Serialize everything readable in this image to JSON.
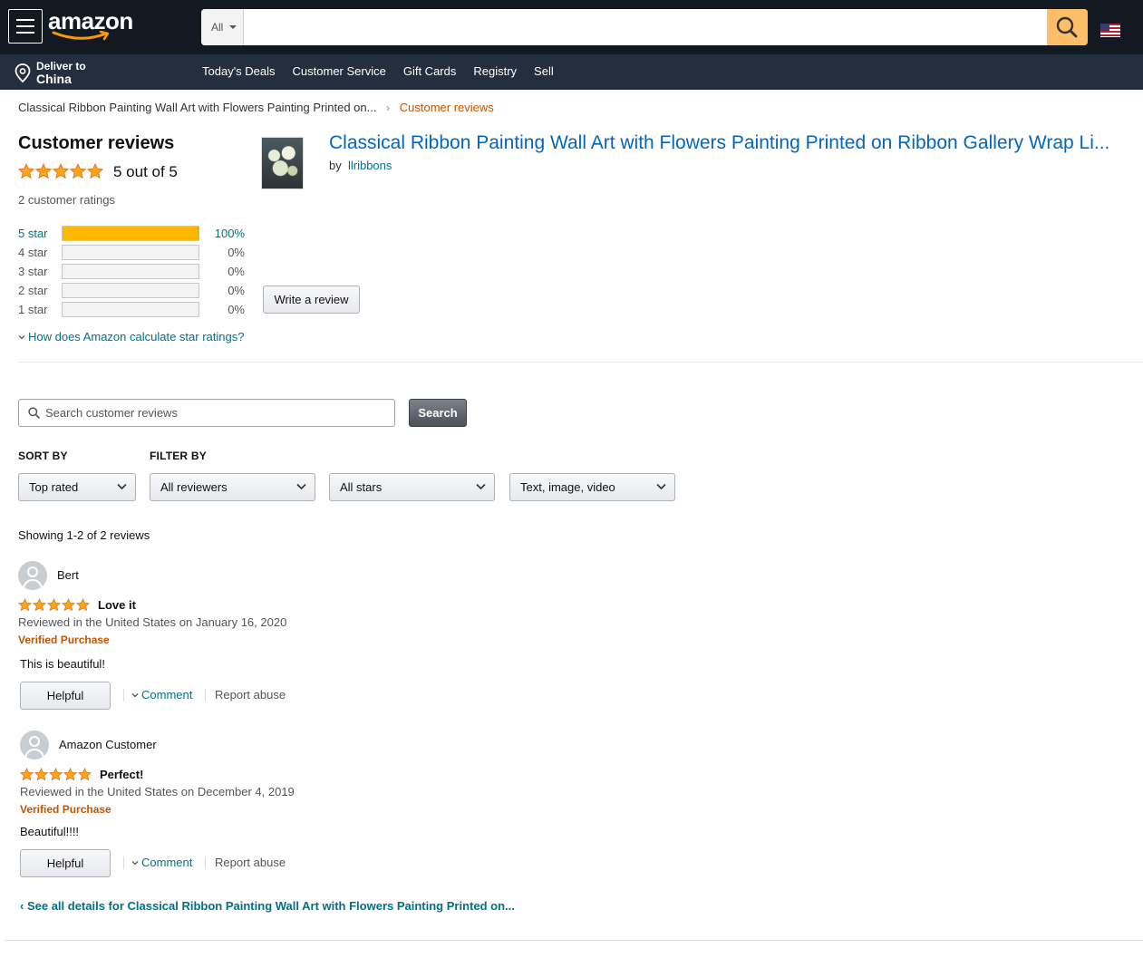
{
  "nav": {
    "logo": "amazon",
    "search_category": "All",
    "search_placeholder": "",
    "deliver_line1": "Deliver to",
    "deliver_line2": "China",
    "links": [
      "Today's Deals",
      "Customer Service",
      "Gift Cards",
      "Registry",
      "Sell"
    ]
  },
  "breadcrumb": {
    "product": "Classical Ribbon Painting Wall Art with Flowers Painting Printed on...",
    "separator": "›",
    "current": "Customer reviews"
  },
  "summary": {
    "title": "Customer reviews",
    "rating": 5,
    "rating_text": "5 out of 5",
    "ratings_count": "2 customer ratings",
    "histogram": [
      {
        "label": "5 star",
        "percent_text": "100%",
        "fill": 1.0
      },
      {
        "label": "4 star",
        "percent_text": "0%",
        "fill": 0
      },
      {
        "label": "3 star",
        "percent_text": "0%",
        "fill": 0
      },
      {
        "label": "2 star",
        "percent_text": "0%",
        "fill": 0
      },
      {
        "label": "1 star",
        "percent_text": "0%",
        "fill": 0
      }
    ],
    "how_link": "How does Amazon calculate star ratings?"
  },
  "product": {
    "title": "Classical Ribbon Painting Wall Art with Flowers Painting Printed on Ribbon Gallery Wrap Li...",
    "by_label": "by",
    "brand": "llribbons",
    "write_review": "Write a review"
  },
  "review_search": {
    "placeholder": "Search customer reviews",
    "button": "Search"
  },
  "filters": {
    "sort_label": "SORT BY",
    "filter_label": "FILTER BY",
    "sort_value": "Top rated",
    "reviewers_value": "All reviewers",
    "stars_value": "All stars",
    "format_value": "Text, image, video"
  },
  "showing": "Showing 1-2 of 2 reviews",
  "reviews": [
    {
      "name": "Bert",
      "rating": 5,
      "title": "Love it",
      "date": "Reviewed in the United States on January 16, 2020",
      "verified": "Verified Purchase",
      "body": "This is beautiful!",
      "helpful": "Helpful",
      "comment": "Comment",
      "report": "Report abuse"
    },
    {
      "name": "Amazon Customer",
      "rating": 5,
      "title": "Perfect!",
      "date": "Reviewed in the United States on December 4, 2019",
      "verified": "Verified Purchase",
      "body": "Beautiful!!!!",
      "helpful": "Helpful",
      "comment": "Comment",
      "report": "Report abuse"
    }
  ],
  "see_all": "See all details for Classical Ribbon Painting Wall Art with Flowers Painting Printed on...",
  "colors": {
    "nav_bg": "#131921",
    "subnav_bg": "#232f3e",
    "search_button": "#febd69",
    "link": "#007185",
    "title_link": "#0066c0",
    "accent_orange": "#c45500",
    "star": "#ffa41c",
    "bar_fill": "#ffb800"
  }
}
